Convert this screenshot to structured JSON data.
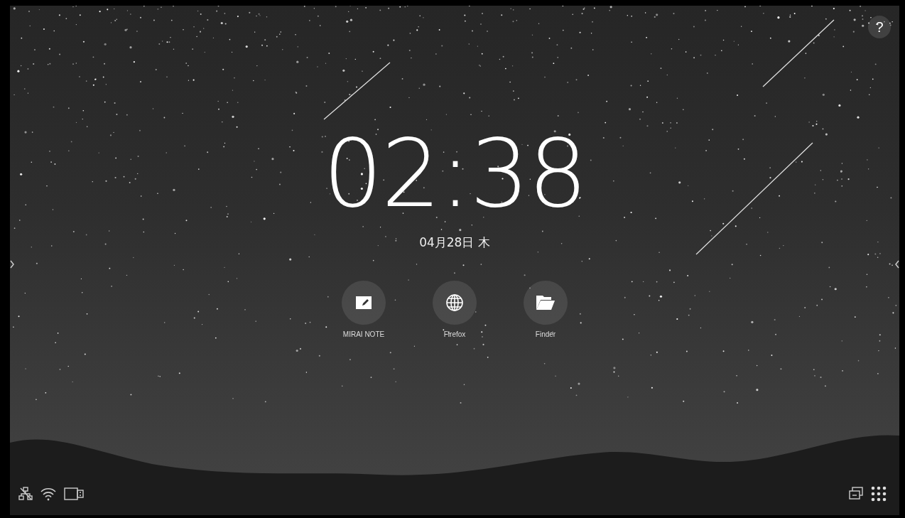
{
  "help_button": {
    "label": "?"
  },
  "clock": {
    "time": "02:38",
    "date": "04月28日 木"
  },
  "apps": [
    {
      "label": "MIRAI NOTE",
      "kind": "note"
    },
    {
      "label": "Firefox",
      "kind": "browser"
    },
    {
      "label": "Finder",
      "kind": "folder"
    }
  ]
}
